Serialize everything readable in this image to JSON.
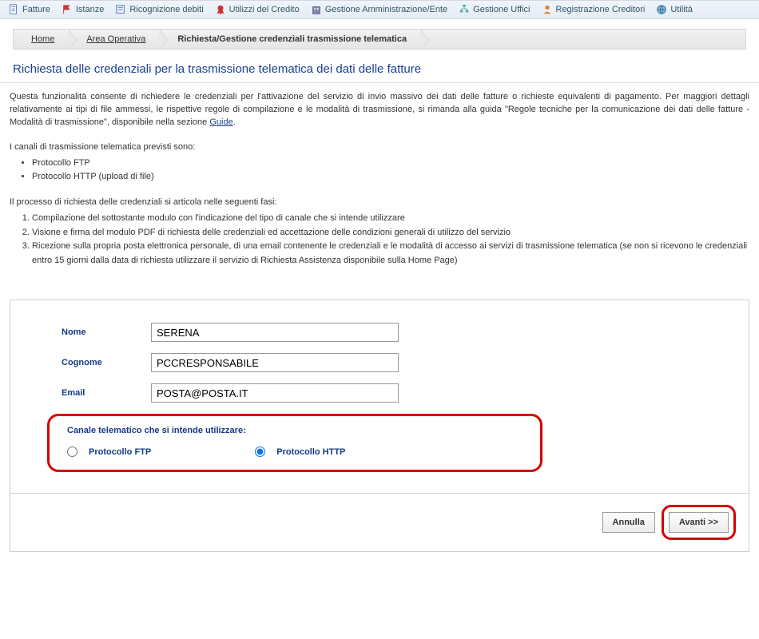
{
  "topbar": {
    "items": [
      {
        "label": "Fatture",
        "icon": "doc-icon"
      },
      {
        "label": "Istanze",
        "icon": "flag-icon"
      },
      {
        "label": "Ricognizione debiti",
        "icon": "page-icon"
      },
      {
        "label": "Utilizzi del Credito",
        "icon": "ribbon-icon"
      },
      {
        "label": "Gestione Amministrazione/Ente",
        "icon": "building-icon"
      },
      {
        "label": "Gestione Uffici",
        "icon": "org-icon"
      },
      {
        "label": "Registrazione Creditori",
        "icon": "user-icon"
      },
      {
        "label": "Utilità",
        "icon": "globe-icon"
      }
    ]
  },
  "breadcrumb": {
    "items": [
      {
        "label": "Home"
      },
      {
        "label": "Area Operativa"
      },
      {
        "label": "Richiesta/Gestione credenziali trasmissione telematica",
        "current": true
      }
    ]
  },
  "page": {
    "title": "Richiesta delle credenziali per la trasmissione telematica dei dati delle fatture",
    "desc": "Questa funzionalità consente di richiedere le credenziali per l'attivazione del servizio di invio massivo dei dati delle fatture o richieste equivalenti di pagamento. Per maggiori dettagli relativamente ai tipi di file ammessi, le rispettive regole di compilazione e le modalità di trasmissione, si rimanda alla guida \"Regole tecniche per la comunicazione dei dati delle fatture - Modalità di trasmissione\", disponibile nella sezione ",
    "guide_link": "Guide",
    "channels_intro": "I canali di trasmissione telematica previsti sono:",
    "channels": [
      "Protocollo FTP",
      "Protocollo HTTP (upload di file)"
    ],
    "process_intro": "Il processo di richiesta delle credenziali si articola nelle seguenti fasi:",
    "process_steps": [
      "Compilazione del sottostante modulo con l'indicazione del tipo di canale che si intende utilizzare",
      "Visione e firma del modulo PDF di richiesta delle credenziali ed accettazione delle condizioni generali di utilizzo del servizio",
      "Ricezione sulla propria posta elettronica personale, di una email contenente le credenziali e le modalità di accesso ai servizi di trasmissione telematica (se non si ricevono le credenziali entro 15 giorni dalla data di richiesta utilizzare il servizio di Richiesta Assistenza disponibile sulla Home Page)"
    ]
  },
  "form": {
    "nome_label": "Nome",
    "nome_value": "SERENA",
    "cognome_label": "Cognome",
    "cognome_value": "PCCRESPONSABILE",
    "email_label": "Email",
    "email_value": "POSTA@POSTA.IT",
    "channel_title": "Canale telematico che si intende utilizzare:",
    "radio_ftp": "Protocollo FTP",
    "radio_http": "Protocollo HTTP",
    "selected": "http",
    "cancel": "Annulla",
    "next": "Avanti >>"
  }
}
